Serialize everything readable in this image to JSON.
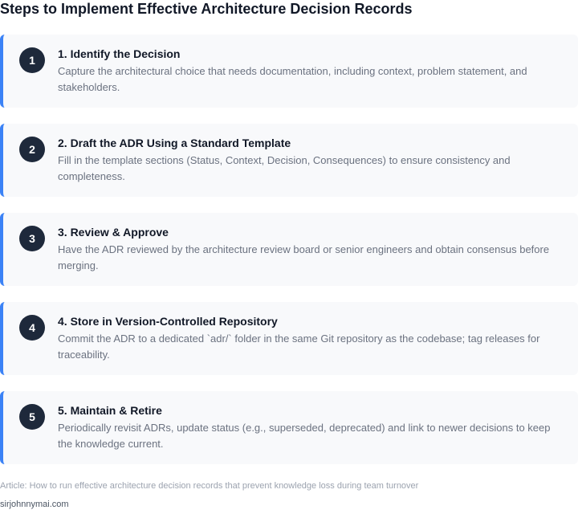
{
  "page": {
    "title": "Steps to Implement Effective Architecture Decision Records"
  },
  "steps": [
    {
      "number": "1",
      "title": "1. Identify the Decision",
      "description": "Capture the architectural choice that needs documentation, including context, problem statement, and stakeholders."
    },
    {
      "number": "2",
      "title": "2. Draft the ADR Using a Standard Template",
      "description": "Fill in the template sections (Status, Context, Decision, Consequences) to ensure consistency and completeness."
    },
    {
      "number": "3",
      "title": "3. Review & Approve",
      "description": "Have the ADR reviewed by the architecture review board or senior engineers and obtain consensus before merging."
    },
    {
      "number": "4",
      "title": "4. Store in Version-Controlled Repository",
      "description": "Commit the ADR to a dedicated `adr/` folder in the same Git repository as the codebase; tag releases for traceability."
    },
    {
      "number": "5",
      "title": "5. Maintain & Retire",
      "description": "Periodically revisit ADRs, update status (e.g., superseded, deprecated) and link to newer decisions to keep the knowledge current."
    }
  ],
  "footer": {
    "article": "Article: How to run effective architecture decision records that prevent knowledge loss during team turnover",
    "site": "sirjohnnymai.com"
  },
  "colors": {
    "accent": "#3b82f6",
    "badge": "#1e293b",
    "card_background": "#f8f9fb"
  }
}
